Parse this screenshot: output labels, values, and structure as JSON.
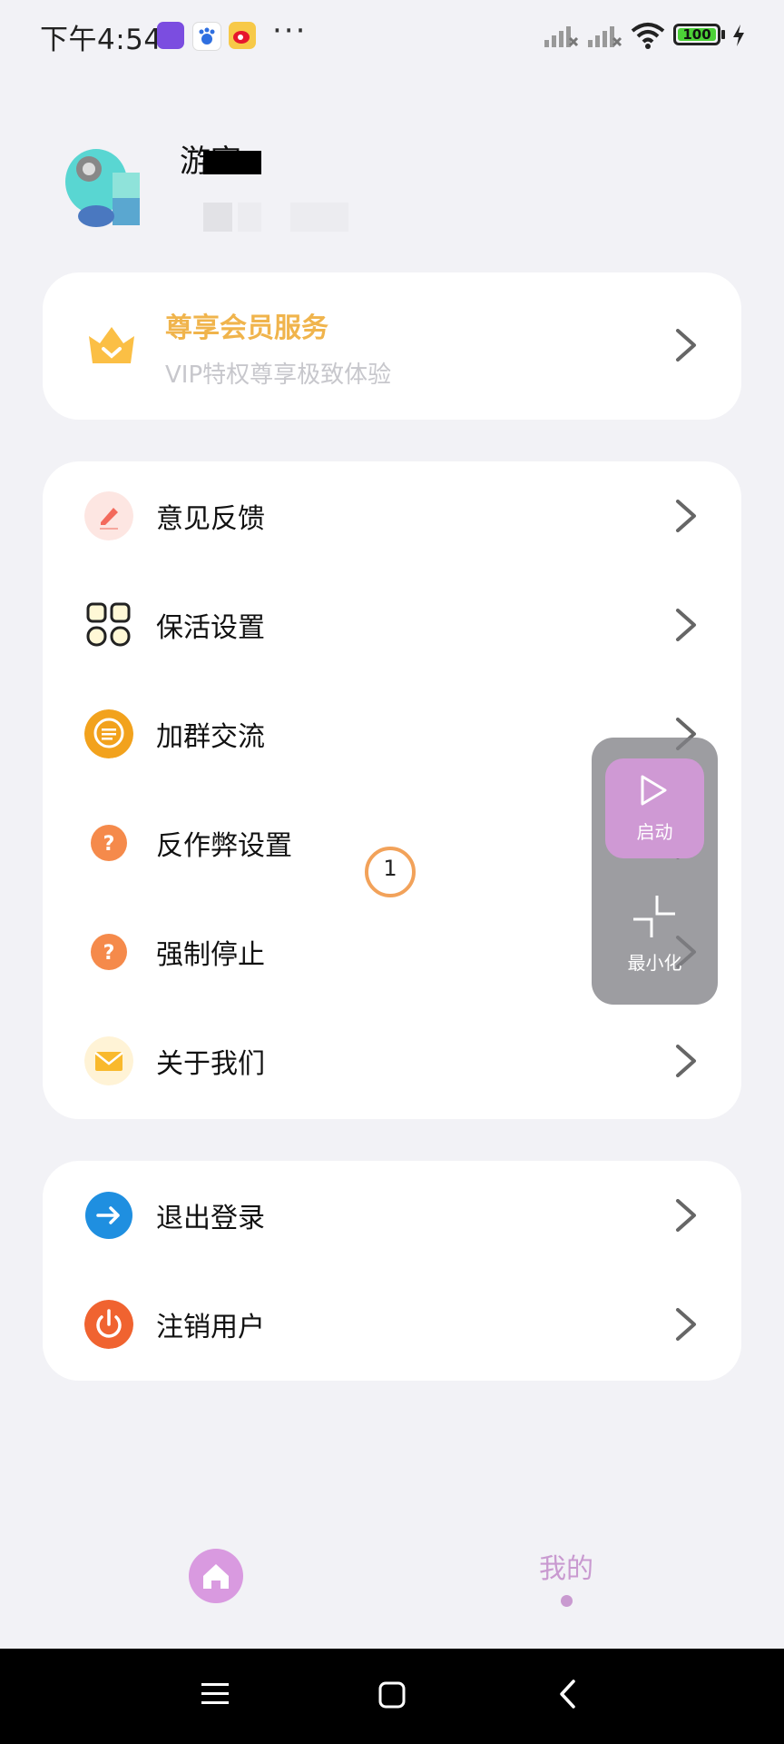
{
  "status_bar": {
    "time": "下午4:54",
    "battery": "100",
    "more": "···"
  },
  "profile": {
    "name": "游客"
  },
  "vip": {
    "title": "尊享会员服务",
    "subtitle": "VIP特权尊享极致体验"
  },
  "menu_group_1": [
    {
      "label": "意见反馈",
      "icon": "feedback-pen-icon"
    },
    {
      "label": "保活设置",
      "icon": "apps-grid-icon"
    },
    {
      "label": "加群交流",
      "icon": "chat-bubble-icon"
    },
    {
      "label": "反作弊设置",
      "icon": "question-icon"
    },
    {
      "label": "强制停止",
      "icon": "question-icon"
    },
    {
      "label": "关于我们",
      "icon": "mail-icon"
    }
  ],
  "menu_group_2": [
    {
      "label": "退出登录",
      "icon": "logout-arrow-icon"
    },
    {
      "label": "注销用户",
      "icon": "power-icon"
    }
  ],
  "floating_panel": {
    "start_label": "启动",
    "minimize_label": "最小化"
  },
  "touch_indicator": "1",
  "tabs": {
    "mine_label": "我的"
  },
  "colors": {
    "accent": "#cf99d4",
    "vip_gold": "#f0b44c",
    "background": "#f2f2f6"
  }
}
